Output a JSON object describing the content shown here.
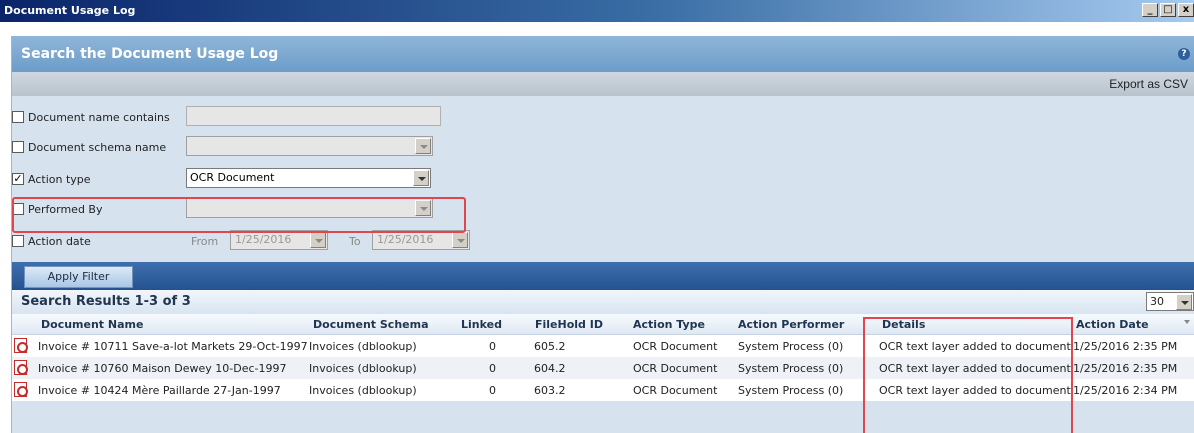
{
  "window": {
    "title": "Document Usage Log"
  },
  "panel": {
    "title": "Search the Document Usage Log",
    "export_label": "Export as CSV"
  },
  "filters": {
    "document_name": {
      "label": "Document name contains",
      "checked": false,
      "value": ""
    },
    "schema_name": {
      "label": "Document schema name",
      "checked": false,
      "value": ""
    },
    "action_type": {
      "label": "Action type",
      "checked": true,
      "value": "OCR Document"
    },
    "performed_by": {
      "label": "Performed By",
      "checked": false,
      "value": ""
    },
    "action_date": {
      "label": "Action date",
      "checked": false,
      "from_label": "From",
      "from_value": "1/25/2016",
      "to_label": "To",
      "to_value": "1/25/2016"
    }
  },
  "apply_label": "Apply Filter",
  "results": {
    "title": "Search Results 1-3 of 3",
    "page_size": "30",
    "columns": [
      "Document Name",
      "Document Schema",
      "Linked",
      "FileHold ID",
      "Action Type",
      "Action Performer",
      "Details",
      "Action Date"
    ],
    "rows": [
      [
        "Invoice # 10711 Save-a-lot Markets 29-Oct-1997",
        "Invoices (dblookup)",
        "0",
        "605.2",
        "OCR Document",
        "System Process (0)",
        "OCR text layer added to document",
        "1/25/2016 2:35 PM"
      ],
      [
        "Invoice # 10760 Maison Dewey 10-Dec-1997",
        "Invoices (dblookup)",
        "0",
        "604.2",
        "OCR Document",
        "System Process (0)",
        "OCR text layer added to document",
        "1/25/2016 2:35 PM"
      ],
      [
        "Invoice # 10424 Mère Paillarde 27-Jan-1997",
        "Invoices (dblookup)",
        "0",
        "603.2",
        "OCR Document",
        "System Process (0)",
        "OCR text layer added to document",
        "1/25/2016 2:34 PM"
      ]
    ]
  },
  "colors": {
    "highlight": "#e0464d",
    "header_blue": "#6c9cc8",
    "apply_bar": "#24528f"
  }
}
